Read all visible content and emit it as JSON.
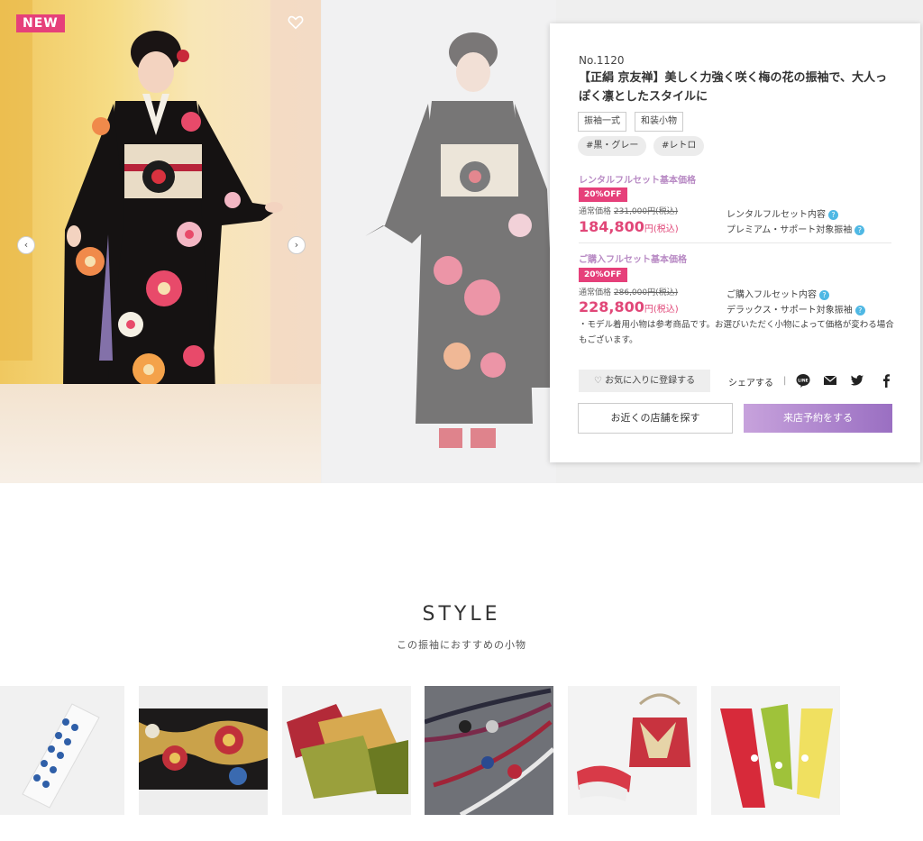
{
  "hero": {
    "badge": "NEW",
    "prev_glyph": "‹",
    "next_glyph": "›"
  },
  "product": {
    "number": "No.1120",
    "title": "【正絹 京友禅】美しく力強く咲く梅の花の振袖で、大人っぽく凛としたスタイルに",
    "tags": [
      "振袖一式",
      "和装小物"
    ],
    "hashtags": [
      "#黒・グレー",
      "#レトロ"
    ]
  },
  "rental": {
    "section_title": "レンタルフルセット基本価格",
    "discount": "20%OFF",
    "regular_label": "通常価格",
    "regular_price": "231,000円(税込)",
    "price": "184,800",
    "price_unit": "円(税込)",
    "links": [
      "レンタルフルセット内容",
      "プレミアム・サポート対象振袖"
    ]
  },
  "purchase": {
    "section_title": "ご購入フルセット基本価格",
    "discount": "20%OFF",
    "regular_label": "通常価格",
    "regular_price": "286,000円(税込)",
    "price": "228,800",
    "price_unit": "円(税込)",
    "links": [
      "ご購入フルセット内容",
      "デラックス・サポート対象振袖"
    ]
  },
  "note": "・モデル着用小物は参考商品です。お選びいただく小物によって価格が変わる場合もございます。",
  "actions": {
    "favorite": "お気に入りに登録する",
    "share": "シェアする",
    "divider": "|",
    "find_store": "お近くの店舗を探す",
    "reserve": "来店予約をする"
  },
  "style": {
    "heading": "STYLE",
    "subheading": "この振袖におすすめの小物"
  },
  "colors": {
    "accent_pink": "#e6407a",
    "price_pink": "#e14778",
    "section_purple": "#b88ac4",
    "reserve_gradient_start": "#c7a2dc",
    "reserve_gradient_end": "#9a6fc2",
    "help_blue": "#4fb8e4"
  }
}
